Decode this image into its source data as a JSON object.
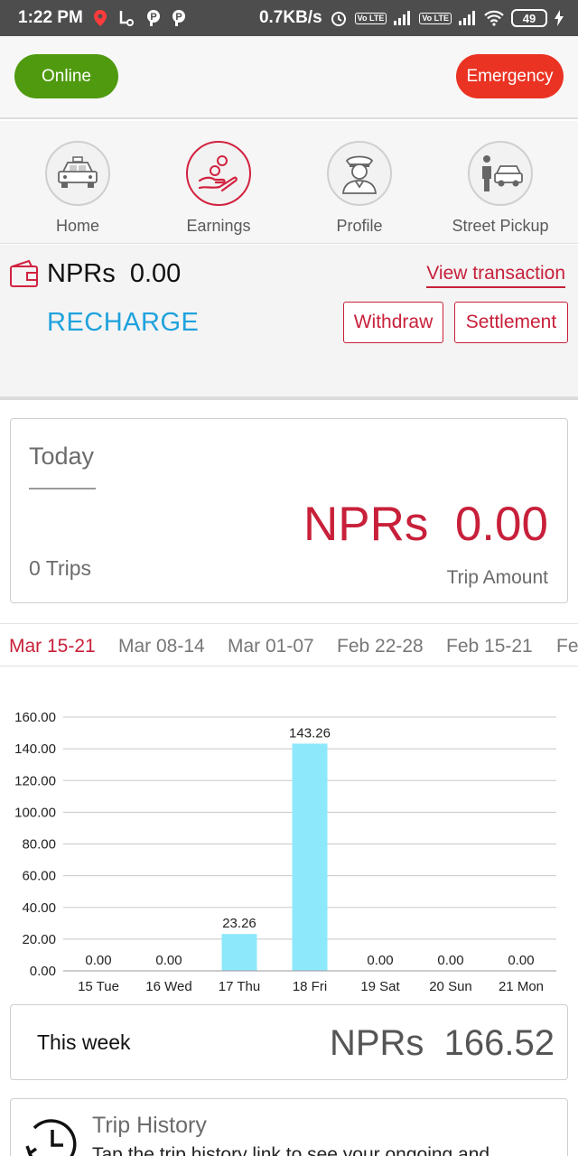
{
  "status_bar": {
    "time": "1:22 PM",
    "speed": "0.7KB/s",
    "lte1": "Vo LTE",
    "lte2": "Vo LTE",
    "battery": "49"
  },
  "header": {
    "online_label": "Online",
    "emergency_label": "Emergency"
  },
  "nav": {
    "items": [
      {
        "label": "Home",
        "icon": "taxi-icon"
      },
      {
        "label": "Earnings",
        "icon": "earnings-hand-coins-icon",
        "active": true
      },
      {
        "label": "Profile",
        "icon": "driver-profile-icon"
      },
      {
        "label": "Street Pickup",
        "icon": "street-pickup-icon"
      }
    ]
  },
  "wallet": {
    "balance": "NPRs  0.00",
    "view_transaction": "View transaction",
    "recharge": "RECHARGE",
    "withdraw": "Withdraw",
    "settlement": "Settlement"
  },
  "today": {
    "title": "Today",
    "amount": "NPRs  0.00",
    "trips": "0 Trips",
    "amount_label": "Trip Amount"
  },
  "week_tabs": [
    "Mar 15-21",
    "Mar 08-14",
    "Mar 01-07",
    "Feb 22-28",
    "Feb 15-21",
    "Fe"
  ],
  "chart_data": {
    "type": "bar",
    "categories": [
      "15 Tue",
      "16 Wed",
      "17 Thu",
      "18 Fri",
      "19 Sat",
      "20 Sun",
      "21 Mon"
    ],
    "values": [
      0.0,
      0.0,
      23.26,
      143.26,
      0.0,
      0.0,
      0.0
    ],
    "value_labels": [
      "0.00",
      "0.00",
      "23.26",
      "143.26",
      "0.00",
      "0.00",
      "0.00"
    ],
    "y_ticks": [
      "0.00",
      "20.00",
      "40.00",
      "60.00",
      "80.00",
      "100.00",
      "120.00",
      "140.00",
      "160.00"
    ],
    "ylim": [
      0,
      160
    ],
    "grid": true,
    "bar_color": "#8ee8fb"
  },
  "week_summary": {
    "label": "This week",
    "amount": "NPRs  166.52"
  },
  "trip_history": {
    "title": "Trip History",
    "description": "Tap the trip history link to see your ongoing and"
  },
  "colors": {
    "accent": "#c8203a",
    "online": "#4f9a0f",
    "emergency": "#ea3323",
    "recharge": "#1ea2dd"
  }
}
